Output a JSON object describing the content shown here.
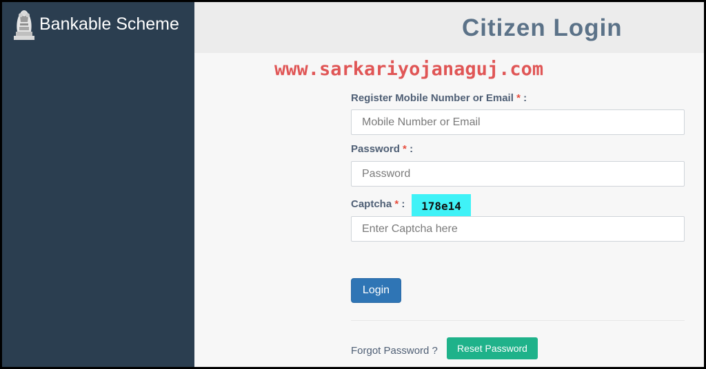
{
  "brand": {
    "name": "Bankable Scheme",
    "logo_icon": "national-emblem-icon"
  },
  "page": {
    "title": "Citizen Login",
    "watermark": "www.sarkariyojanaguj.com"
  },
  "form": {
    "mobile_label": "Register Mobile Number or Email",
    "mobile_placeholder": "Mobile Number or Email",
    "password_label": "Password",
    "password_placeholder": "Password",
    "captcha_label": "Captcha",
    "captcha_code": "178e14",
    "captcha_placeholder": "Enter Captcha here",
    "required_marker": "*",
    "colon": ":",
    "login_label": "Login",
    "forgot_text": "Forgot Password ?",
    "reset_label": "Reset Password"
  },
  "colors": {
    "sidebar": "#2b3e50",
    "title": "#5b7288",
    "watermark": "#e05656",
    "login_button": "#2f75b5",
    "reset_button": "#1fb28a",
    "captcha_bg": "#3ff2f7"
  }
}
